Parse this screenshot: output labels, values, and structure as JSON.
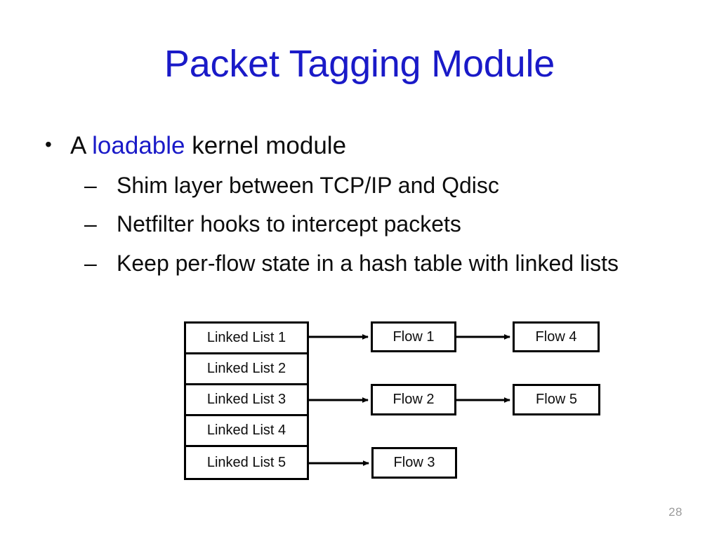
{
  "slide": {
    "title": "Packet Tagging Module",
    "page_number": "28",
    "title_color": "#1A1AC8",
    "accent_color": "#1A1AC8",
    "text_color": "#0D0D0D",
    "background_color": "#FFFFFF"
  },
  "bullets": {
    "level1": {
      "marker": "•",
      "prefix": "A ",
      "highlight": "loadable",
      "suffix": " kernel module"
    },
    "level2": [
      {
        "marker": "–",
        "text": "Shim layer between TCP/IP and Qdisc"
      },
      {
        "marker": "–",
        "text": "Netfilter hooks to intercept packets"
      },
      {
        "marker": "–",
        "text": "Keep per-flow state in a hash table with linked lists"
      }
    ]
  },
  "diagram": {
    "hash_table": {
      "cells": [
        "Linked List 1",
        "Linked List 2",
        "Linked List 3",
        "Linked List 4",
        "Linked List 5"
      ]
    },
    "flows": {
      "flow1": "Flow 1",
      "flow2": "Flow 2",
      "flow3": "Flow 3",
      "flow4": "Flow 4",
      "flow5": "Flow 5"
    },
    "connections": [
      {
        "from": "Linked List 1",
        "to": "Flow 1"
      },
      {
        "from": "Flow 1",
        "to": "Flow 4"
      },
      {
        "from": "Linked List 3",
        "to": "Flow 2"
      },
      {
        "from": "Flow 2",
        "to": "Flow 5"
      },
      {
        "from": "Linked List 5",
        "to": "Flow 3"
      }
    ],
    "line_color": "#000000"
  }
}
